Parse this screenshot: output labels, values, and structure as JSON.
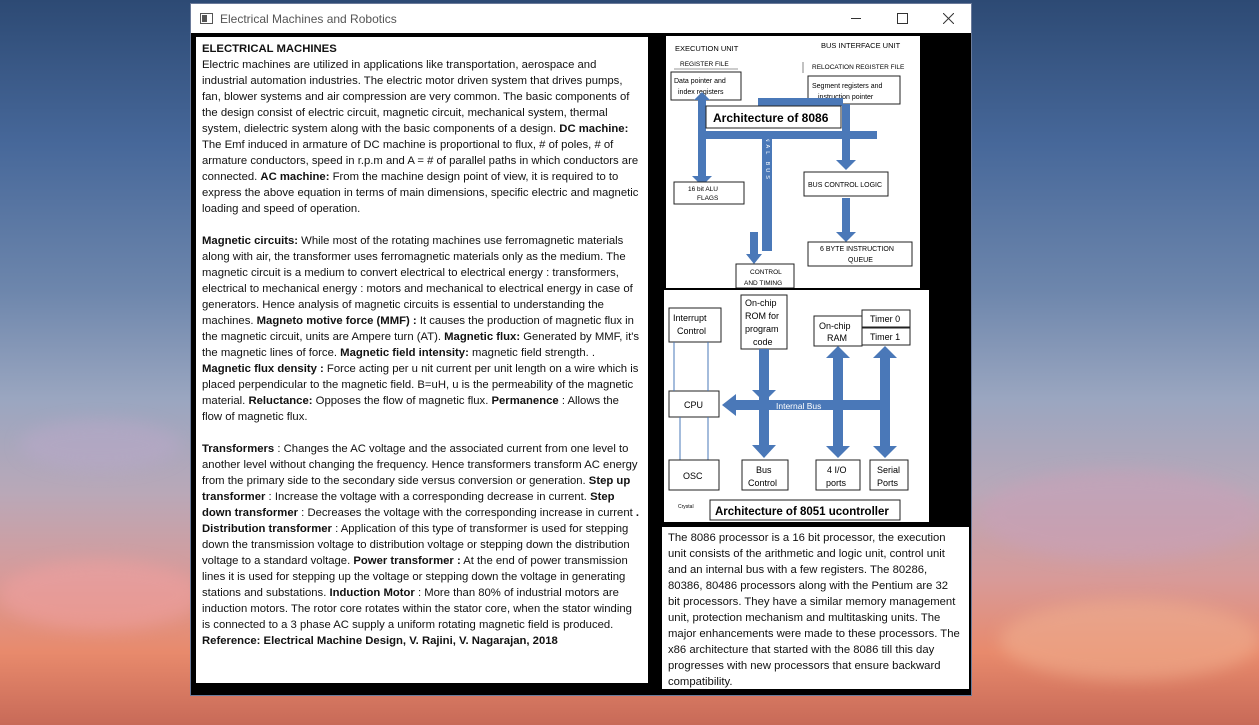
{
  "window": {
    "title": "Electrical Machines and Robotics",
    "minimize_icon": "minimize-icon",
    "maximize_icon": "maximize-icon",
    "close_icon": "close-icon"
  },
  "main_text": {
    "p1": {
      "heading": "ELECTRICAL MACHINES",
      "t1": "Electric machines are utilized in applications like transportation, aerospace and industrial automation industries. The electric motor driven system that drives pumps, fan, blower systems and air compression are very common.  The basic components of the design consist of electric circuit, magnetic circuit, mechanical system, thermal system, dielectric system along with the basic components of a design.      ",
      "b1": "DC machine:",
      "t2": "     The Emf induced in armature of DC machine is proportional to flux, # of poles, # of armature conductors, speed in r.p.m and A = # of parallel paths in which conductors are connected.     ",
      "b2": "AC machine:",
      "t3": "     From the machine design point of view, it is required to to express the above equation in terms of main dimensions, specific electric and magnetic loading and speed of operation."
    },
    "p2": {
      "b1": "Magnetic circuits:",
      "t1": "     While most of the rotating machines use ferromagnetic materials along with air, the transformer uses ferromagnetic materials only as the medium.   The magnetic circuit is a medium to convert electrical to electrical energy : transformers, electrical to mechanical energy : motors  and mechanical to electrical energy in case of generators.  Hence analysis of magnetic circuits is essential to understanding the machines.     ",
      "b2": "Magneto motive force (MMF) :",
      "t2": "     It causes the production of magnetic flux in the magnetic circuit, units are Ampere turn (AT).     ",
      "b3": "Magnetic flux:",
      "t3": "     Generated by MMF, it's the magnetic lines of force.  ",
      "b4": "Magnetic field intensity:",
      "t4": "   magnetic field strength.  .    ",
      "b5": "Magnetic flux density :",
      "t5": " Force acting per u nit current per unit length on a wire which is placed perpendicular to the magnetic field. B=uH, u is the permeability of the magnetic material.  ",
      "b6": "Reluctance:",
      "t6": "   Opposes the flow of magnetic flux.    ",
      "b7": "Permanence",
      "t7": "   : Allows the flow of magnetic flux."
    },
    "p3": {
      "b1": "Transformers",
      "t1": "   : Changes the AC voltage and the associated current from one level to another level without changing the frequency.  Hence transformers transform AC energy from the primary side to the secondary side versus conversion or generation.  ",
      "b2": "Step up transformer",
      "t2": "   : Increase the voltage with a corresponding decrease in current.    ",
      "b3": "Step down transformer",
      "t3": "   : Decreases the voltage with the corresponding increase in current    ",
      "b4": ". Distribution transformer",
      "t4": "   : Application of this type of transformer is used for stepping down the transmission voltage to distribution voltage or stepping down the distribution voltage to a standard voltage.    ",
      "b5": "Power transformer :",
      "t5": "    At the end of power transmission lines it is used for stepping up the voltage or stepping down the voltage in generating stations and substations.  ",
      "b6": "Induction Motor",
      "t6": "   : More than 80% of industrial motors are induction motors.  The rotor core rotates within the stator core, when the stator winding is connected to a 3 phase AC supply a uniform rotating magnetic field is produced.    ",
      "b7": "Reference: Electrical Machine Design, V. Rajini, V. Nagarajan, 2018"
    }
  },
  "diagram_8086": {
    "title": "Architecture of 8086",
    "execution_unit": "EXECUTION UNIT",
    "bus_interface_unit": "BUS INTERFACE UNIT",
    "register_file": "REGISTER FILE",
    "relocation_register_file": "RELOCATION REGISTER FILE",
    "data_pointer_l1": "Data pointer and",
    "data_pointer_l2": "index registers",
    "segment_l1": "Segment registers and",
    "segment_l2": "instruction pointer",
    "alu_l1": "16 bit ALU",
    "alu_l2": "FLAGS",
    "bus_control": "BUS CONTROL LOGIC",
    "queue_l1": "6 BYTE INSTRUCTION",
    "queue_l2": "QUEUE",
    "control_l1": "CONTROL",
    "control_l2": "AND TIMING",
    "internal_bus_vertical": "INTERNAL BUS"
  },
  "diagram_8051": {
    "title": "Architecture of 8051 ucontroller",
    "interrupt_l1": "Interrupt",
    "interrupt_l2": "Control",
    "rom_l1": "On-chip",
    "rom_l2": "ROM for",
    "rom_l3": "program",
    "rom_l4": "code",
    "ram_l1": "On-chip",
    "ram_l2": "RAM",
    "timer0": "Timer 0",
    "timer1": "Timer 1",
    "cpu": "CPU",
    "internal_bus": "Internal Bus",
    "osc": "OSC",
    "bus_control_l1": "Bus",
    "bus_control_l2": "Control",
    "io_l1": "4 I/O",
    "io_l2": "ports",
    "serial_l1": "Serial",
    "serial_l2": "Ports",
    "crystal": "Crystal"
  },
  "description": "The 8086 processor is a 16 bit processor, the execution unit consists of the arithmetic and logic unit, control unit and an internal bus with a few registers.   The 80286, 80386, 80486 processors along with the Pentium are 32 bit processors.  They have a similar memory management unit, protection mechanism and multitasking units.   The major enhancements were made to these processors.    The x86 architecture that started with the 8086 till this day progresses with new processors that ensure backward compatibility.",
  "colors": {
    "arrow_blue": "#4a78b8",
    "window_bg": "#000000",
    "titlebar_bg": "#ffffff"
  }
}
